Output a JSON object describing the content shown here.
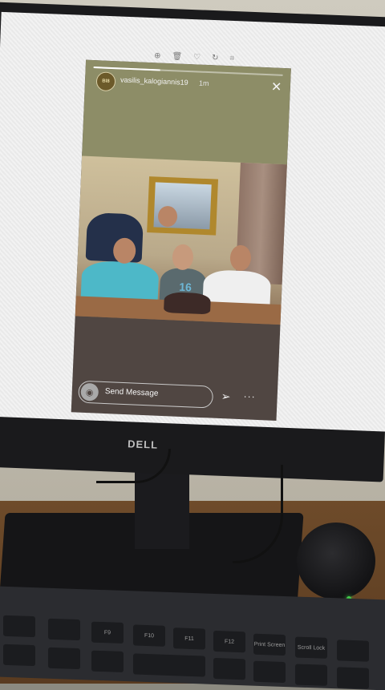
{
  "monitor": {
    "brand": "DELL"
  },
  "story": {
    "username": "vasilis_kalogiannis19",
    "time": "1m",
    "avatar_text": "Bl8",
    "progress": 0.35,
    "message_placeholder": "Send Message",
    "candle_text": "16"
  },
  "toolbar": {
    "icons": [
      "zoom-in-icon",
      "delete-icon",
      "heart-icon",
      "rotate-icon",
      "crop-icon"
    ]
  },
  "keyboard": {
    "keys": [
      "F9",
      "F10",
      "F11",
      "F12",
      "Print Screen",
      "Scroll Lock"
    ]
  }
}
